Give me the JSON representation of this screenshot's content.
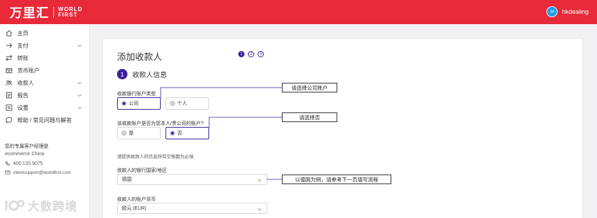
{
  "brand": {
    "logo_cn": "万里汇",
    "logo_en_line1": "WORLD",
    "logo_en_line2": "FIRST",
    "color": "#e8293a"
  },
  "user": {
    "avatar_initial": "H",
    "name": "hkdealing"
  },
  "sidebar": {
    "items": [
      {
        "label": "主页",
        "icon": "home-icon",
        "has_chevron": false
      },
      {
        "label": "支付",
        "icon": "arrow-right-icon",
        "has_chevron": true
      },
      {
        "label": "转账",
        "icon": "transfer-icon",
        "has_chevron": false
      },
      {
        "label": "货币账户",
        "icon": "wallet-icon",
        "has_chevron": false
      },
      {
        "label": "收款人",
        "icon": "users-icon",
        "has_chevron": true
      },
      {
        "label": "报告",
        "icon": "report-icon",
        "has_chevron": true
      },
      {
        "label": "设置",
        "icon": "settings-icon",
        "has_chevron": true
      },
      {
        "label": "帮助 / 常见问题与解答",
        "icon": "help-chat-icon",
        "has_chevron": false
      }
    ],
    "relationship_manager": {
      "title": "您的专属客户经理是",
      "region": "ecommerce China",
      "phone": "400 120 9075",
      "email": "clientsupport@worldfirst.com"
    },
    "watermark": "大数跨境"
  },
  "main": {
    "title": "添加收款人",
    "steps": [
      "1",
      "2",
      "3"
    ],
    "active_step": 1,
    "section": {
      "number": "1",
      "title": "收款人信息"
    },
    "q_account_type": {
      "label": "收款银行账户类型",
      "options": [
        "公司",
        "个人"
      ],
      "selected": "公司"
    },
    "q_own_account": {
      "label": "该收款账户是否为您本人/贵公司的账户?",
      "options": [
        "是",
        "否"
      ],
      "selected": "否"
    },
    "hint": "请提供收款人的信息所有空格都为必填",
    "country": {
      "label": "收款人的银行国家/地区",
      "value": "德国"
    },
    "currency": {
      "label": "收款人的账户货币",
      "value": "欧元 (EUR)"
    }
  },
  "callouts": {
    "account_type": "请选择公司账户",
    "own_account": "请选择否",
    "country": "以德国为例，请参考下一页填写流程"
  },
  "accent_color": "#3a1f9c"
}
